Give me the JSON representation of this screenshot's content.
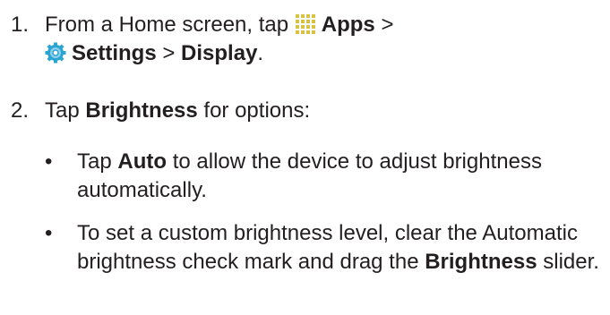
{
  "steps": [
    {
      "number": "1.",
      "t1": "From a Home screen, tap",
      "apps": "Apps",
      "t2": ">",
      "settings": "Settings",
      "t3": ">",
      "display": "Display",
      "t4": ".",
      "icons": [
        "apps-grid-icon",
        "settings-gear-icon"
      ]
    },
    {
      "number": "2.",
      "t1": "Tap",
      "brightness": "Brightness",
      "t2": "for options:"
    }
  ],
  "bullets": [
    {
      "marker": "•",
      "t1": "Tap",
      "auto": "Auto",
      "t2": "to allow the device to adjust brightness automatically."
    },
    {
      "marker": "•",
      "t1": "To set a custom brightness level, clear the Automatic brightness check mark and drag the",
      "brightness": "Brightness",
      "t2": "slider."
    }
  ],
  "colors": {
    "text": "#231f20",
    "apps_icon": "#d9c240",
    "settings_icon_outer": "#2aa4d0",
    "settings_icon_inner": "#8fd0ea"
  }
}
